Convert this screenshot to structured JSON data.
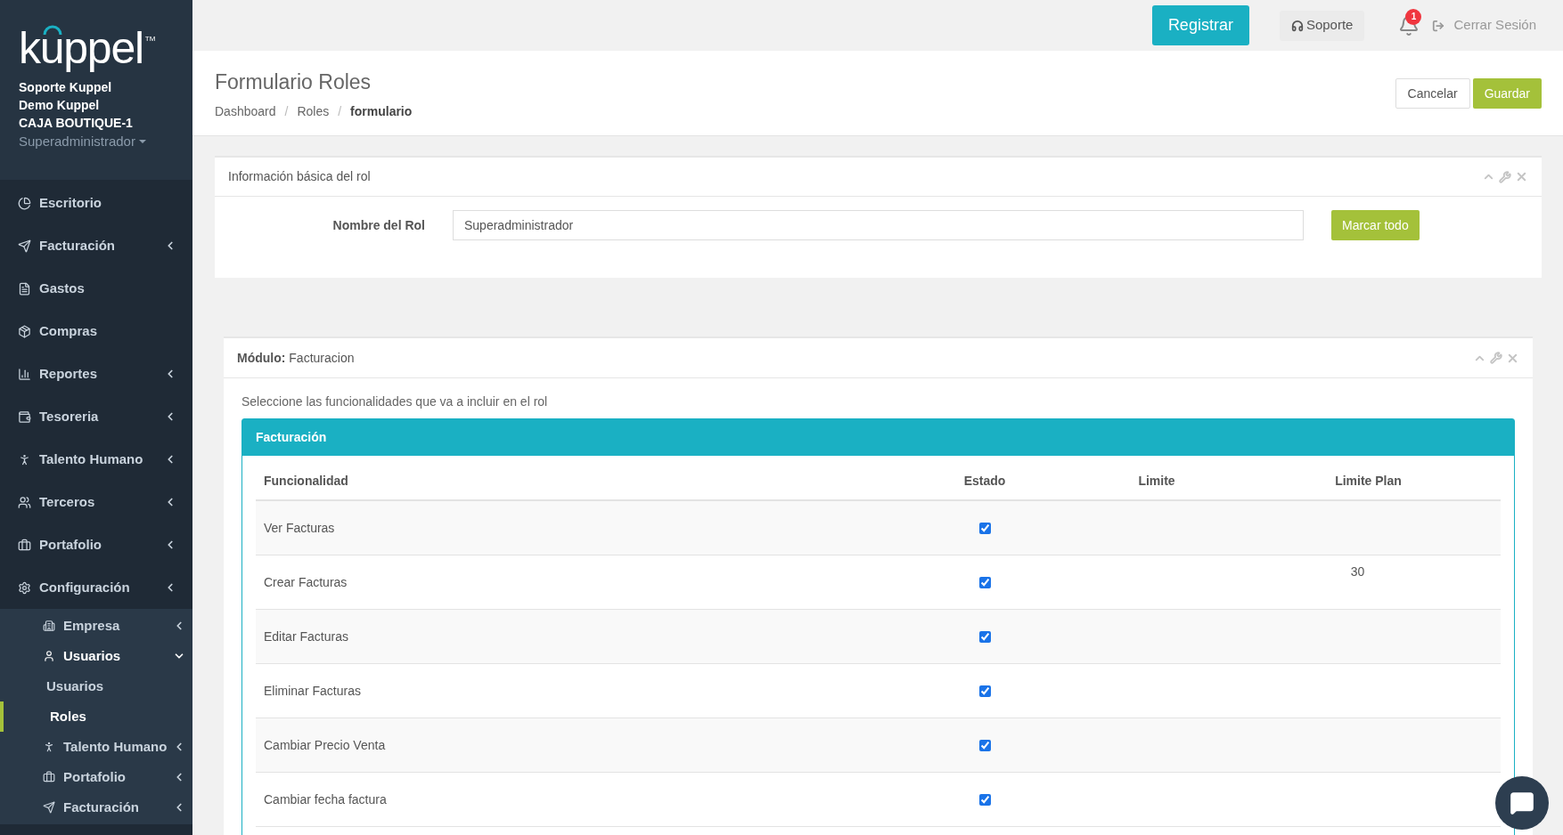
{
  "sidebar": {
    "logo": {
      "text": "kuppel",
      "tm": "TM"
    },
    "user_lines": [
      "Soporte Kuppel",
      "Demo Kuppel",
      "CAJA BOUTIQUE-1"
    ],
    "role": "Superadministrador",
    "menu": [
      {
        "label": "Escritorio"
      },
      {
        "label": "Facturación",
        "expanded": false
      },
      {
        "label": "Gastos"
      },
      {
        "label": "Compras"
      },
      {
        "label": "Reportes",
        "expanded": false
      },
      {
        "label": "Tesoreria",
        "expanded": false
      },
      {
        "label": "Talento Humano",
        "expanded": false
      },
      {
        "label": "Terceros",
        "expanded": false
      },
      {
        "label": "Portafolio",
        "expanded": false
      },
      {
        "label": "Configuración",
        "expanded": false,
        "children": [
          {
            "label": "Empresa",
            "expanded": false
          },
          {
            "label": "Usuarios",
            "expanded": true,
            "children": [
              {
                "label": "Usuarios",
                "selected": false
              },
              {
                "label": "Roles",
                "selected": true
              }
            ]
          },
          {
            "label": "Talento Humano",
            "expanded": false
          },
          {
            "label": "Portafolio",
            "expanded": false
          },
          {
            "label": "Facturación",
            "expanded": false
          }
        ]
      }
    ]
  },
  "topbar": {
    "register": "Registrar",
    "support": "Soporte",
    "notification_count": "1",
    "logout": "Cerrar Sesión"
  },
  "page_header": {
    "title": "Formulario Roles",
    "breadcrumbs": [
      {
        "label": "Dashboard",
        "current": false
      },
      {
        "label": "Roles",
        "current": false
      },
      {
        "label": "formulario",
        "current": true
      }
    ],
    "separator": "/",
    "buttons": {
      "cancel": "Cancelar",
      "save": "Guardar"
    }
  },
  "basic_panel": {
    "title": "Información básica del rol",
    "label": "Nombre del Rol",
    "value": "Superadministrador",
    "mark_all": "Marcar todo"
  },
  "module_panel": {
    "title": "**Módulo:** Facturacion",
    "instruction": "Seleccione las funcionalidades que va a incluir en el rol",
    "box_title": "Facturación",
    "columns": [
      "Funcionalidad",
      "Estado",
      "Limite",
      "Limite Plan"
    ],
    "rows": [
      {
        "name": "Ver Facturas",
        "checked": true
      },
      {
        "name": "Crear Facturas",
        "checked": true,
        "limit_plan": "30"
      },
      {
        "name": "Editar Facturas",
        "checked": true
      },
      {
        "name": "Eliminar Facturas",
        "checked": true
      },
      {
        "name": "Cambiar Precio Venta",
        "checked": true
      },
      {
        "name": "Cambiar fecha factura",
        "checked": true
      }
    ]
  }
}
